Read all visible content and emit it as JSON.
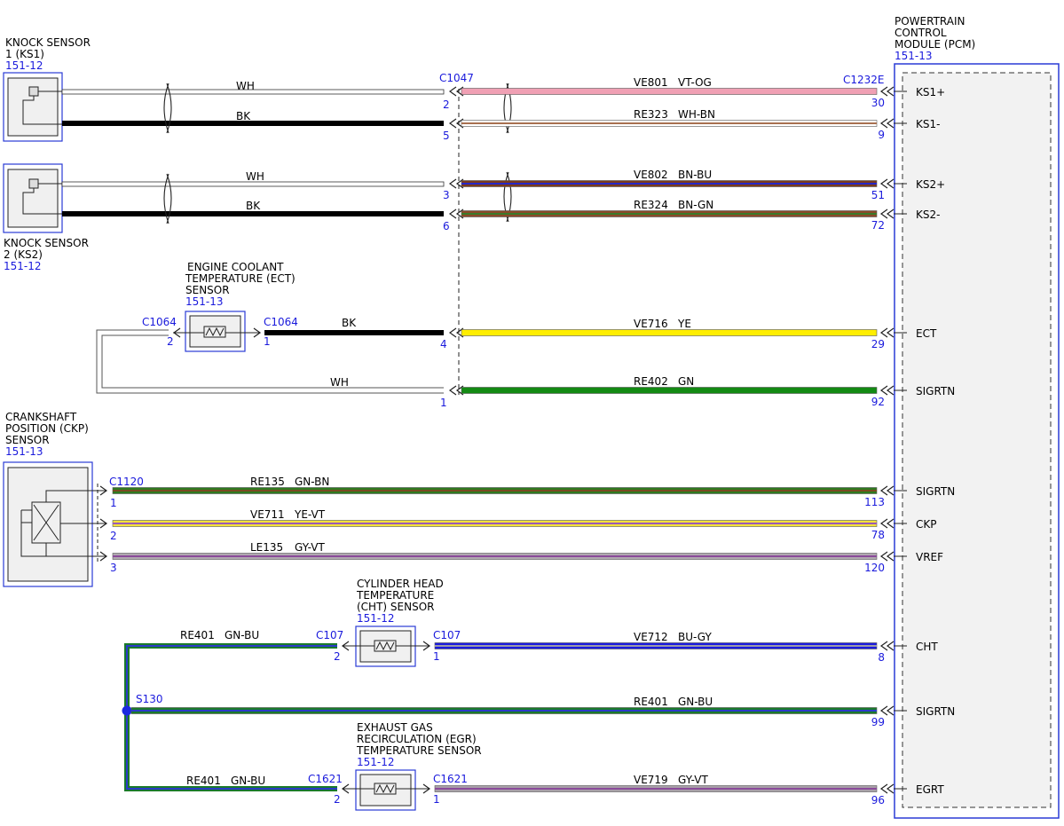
{
  "colors": {
    "link": "#1a1adc",
    "module_border": "#2a3bd6",
    "sensor_fill": "#f0f0f0",
    "module_fill": "#f2f2f2"
  },
  "pcm": {
    "title_lines": [
      "POWERTRAIN",
      "CONTROL",
      "MODULE (PCM)"
    ],
    "ref": "151-13",
    "connector": "C1232E"
  },
  "central_connector": {
    "id": "C1047"
  },
  "sensors": {
    "ks1": {
      "lines": [
        "KNOCK SENSOR",
        "1 (KS1)"
      ],
      "ref": "151-12"
    },
    "ks2": {
      "lines": [
        "KNOCK SENSOR",
        "2 (KS2)"
      ],
      "ref": "151-12"
    },
    "ect": {
      "lines": [
        "ENGINE COOLANT",
        "TEMPERATURE (ECT)",
        "SENSOR"
      ],
      "ref": "151-13",
      "conn_left": "C1064",
      "pin_left": "2",
      "conn_right": "C1064",
      "pin_right": "1"
    },
    "ckp": {
      "lines": [
        "CRANKSHAFT",
        "POSITION (CKP)",
        "SENSOR"
      ],
      "ref": "151-13",
      "connector": "C1120"
    },
    "cht": {
      "lines": [
        "CYLINDER HEAD",
        "TEMPERATURE",
        "(CHT) SENSOR"
      ],
      "ref": "151-12",
      "conn_left": "C107",
      "pin_left": "2",
      "conn_right": "C107",
      "pin_right": "1"
    },
    "egr": {
      "lines": [
        "EXHAUST GAS",
        "RECIRCULATION (EGR)",
        "TEMPERATURE SENSOR"
      ],
      "ref": "151-12",
      "conn_left": "C1621",
      "pin_left": "2",
      "conn_right": "C1621",
      "pin_right": "1"
    }
  },
  "splice": {
    "id": "S130"
  },
  "left_wires": [
    {
      "label": "WH"
    },
    {
      "label": "BK"
    },
    {
      "label": "WH"
    },
    {
      "label": "BK"
    },
    {
      "label": "BK"
    },
    {
      "label": "WH"
    }
  ],
  "left_pins": [
    "2",
    "5",
    "3",
    "6",
    "4",
    "1"
  ],
  "ckp_pins": [
    "1",
    "2",
    "3"
  ],
  "circuits": [
    {
      "circuit": "VE801",
      "color": "VT-OG",
      "pcm_pin": "30",
      "signal": "KS1+",
      "c1": "#f0a0b4",
      "c2": "#f0a0b4"
    },
    {
      "circuit": "RE323",
      "color": "WH-BN",
      "pcm_pin": "9",
      "signal": "KS1-",
      "c1": "#ffffff",
      "c2": "#a87050"
    },
    {
      "circuit": "VE802",
      "color": "BN-BU",
      "pcm_pin": "51",
      "signal": "KS2+",
      "c1": "#7a3a1e",
      "c2": "#2626c8"
    },
    {
      "circuit": "RE324",
      "color": "BN-GN",
      "pcm_pin": "72",
      "signal": "KS2-",
      "c1": "#8a4a28",
      "c2": "#3a7a2a"
    },
    {
      "circuit": "VE716",
      "color": "YE",
      "pcm_pin": "29",
      "signal": "ECT",
      "c1": "#ffee00",
      "c2": "#ffee00"
    },
    {
      "circuit": "RE402",
      "color": "GN",
      "pcm_pin": "92",
      "signal": "SIGRTN",
      "c1": "#138a13",
      "c2": "#138a13"
    },
    {
      "circuit": "RE135",
      "color": "GN-BN",
      "pcm_pin": "113",
      "signal": "SIGRTN",
      "c1": "#2f7a1f",
      "c2": "#7a4a22"
    },
    {
      "circuit": "VE711",
      "color": "YE-VT",
      "pcm_pin": "78",
      "signal": "CKP",
      "c1": "#f4e23a",
      "c2": "#9a5ab8"
    },
    {
      "circuit": "LE135",
      "color": "GY-VT",
      "pcm_pin": "120",
      "signal": "VREF",
      "c1": "#b0a8b0",
      "c2": "#8a4a9a"
    },
    {
      "circuit": "VE712",
      "color": "BU-GY",
      "pcm_pin": "8",
      "signal": "CHT",
      "c1": "#1a1ae0",
      "c2": "#9a9aaa"
    },
    {
      "circuit": "RE401",
      "color": "GN-BU",
      "pcm_pin": "99",
      "signal": "SIGRTN",
      "c1": "#1a7a2a",
      "c2": "#2a3ac8"
    },
    {
      "circuit": "VE719",
      "color": "GY-VT",
      "pcm_pin": "96",
      "signal": "EGRT",
      "c1": "#a8a0a8",
      "c2": "#8a4a9a"
    }
  ],
  "splice_branches": [
    {
      "circuit": "RE401",
      "color": "GN-BU"
    },
    {
      "circuit": "RE401",
      "color": "GN-BU"
    }
  ]
}
